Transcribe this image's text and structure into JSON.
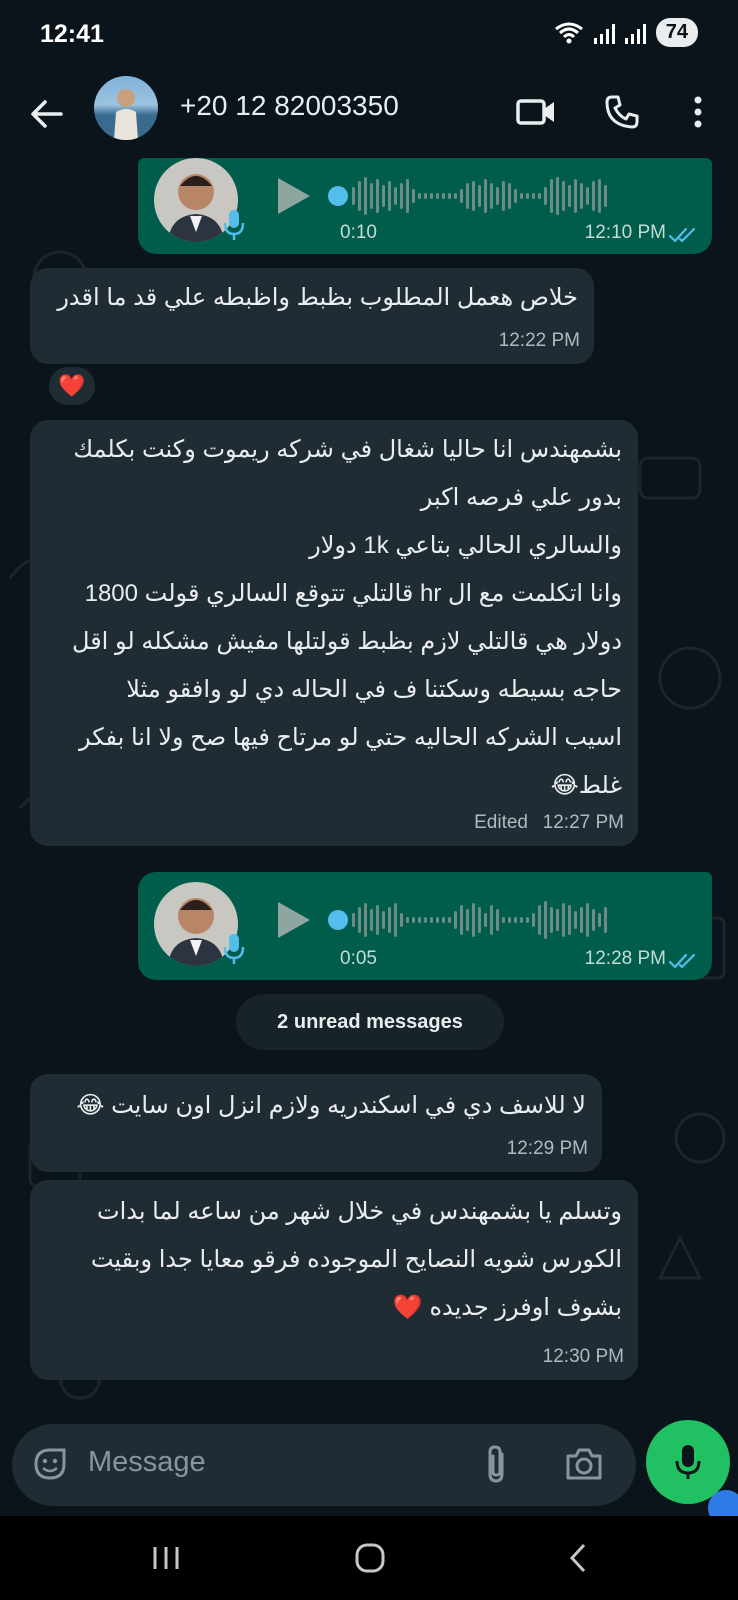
{
  "status_bar": {
    "time": "12:41",
    "battery": "74"
  },
  "header": {
    "contact_name": "+20 12 82003350",
    "icons": [
      "back-arrow-icon",
      "video-call-icon",
      "phone-icon",
      "more-options-icon"
    ]
  },
  "messages": [
    {
      "type": "voice",
      "direction": "outgoing",
      "duration": "0:10",
      "time": "12:10 PM",
      "status": "read"
    },
    {
      "type": "text",
      "direction": "incoming",
      "text": "خلاص هعمل المطلوب بظبط واظبطه علي قد ما اقدر",
      "time": "12:22 PM",
      "reaction": "❤️"
    },
    {
      "type": "text",
      "direction": "incoming",
      "lines": [
        "بشمهندس انا حاليا شغال في شركه ريموت وكنت بكلمك",
        "بدور علي فرصه اكبر",
        "والسالري الحالي بتاعي 1k دولار",
        "وانا اتكلمت مع ال hr قالتلي تتوقع السالري قولت 1800",
        "دولار هي قالتلي لازم بظبط قولتلها مفيش مشكله لو اقل",
        "حاجه بسيطه وسكتنا ف في الحاله دي لو وافقو مثلا",
        "اسيب الشركه الحاليه حتي لو مرتاح فيها صح ولا انا بفكر",
        "غلط😂"
      ],
      "edited_label": "Edited",
      "time": "12:27 PM"
    },
    {
      "type": "voice",
      "direction": "outgoing",
      "duration": "0:05",
      "time": "12:28 PM",
      "status": "read"
    },
    {
      "type": "text",
      "direction": "incoming",
      "text": "لا للاسف دي في اسكندريه ولازم انزل اون سايت 😂",
      "time": "12:29 PM"
    },
    {
      "type": "text",
      "direction": "incoming",
      "lines": [
        "وتسلم يا بشمهندس في خلال شهر من ساعه لما بدات",
        "الكورس شويه النصايح الموجوده فرقو معايا جدا وبقيت",
        "بشوف اوفرز جديده ❤️"
      ],
      "time": "12:30 PM"
    }
  ],
  "unread_divider": "2 unread messages",
  "composer": {
    "placeholder": "Message",
    "icons": [
      "sticker-icon",
      "attach-icon",
      "camera-icon",
      "mic-icon"
    ]
  },
  "colors": {
    "incoming": "#202c33",
    "outgoing": "#005c4b",
    "accent": "#21c063",
    "tick": "#53bdeb",
    "background": "#0b141a"
  }
}
